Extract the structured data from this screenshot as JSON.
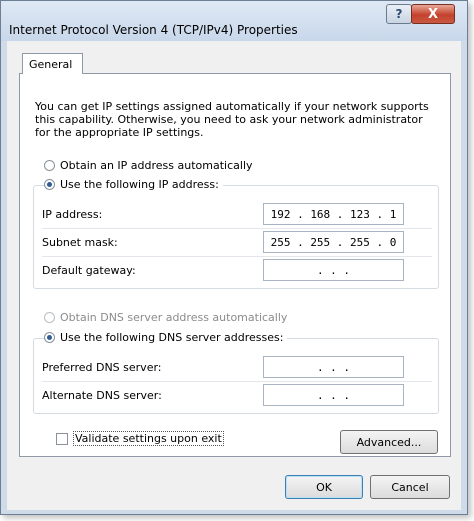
{
  "window": {
    "title": "Internet Protocol Version 4 (TCP/IPv4) Properties",
    "help_label": "?",
    "close_label": "X"
  },
  "tabs": [
    {
      "label": "General",
      "selected": true
    }
  ],
  "description": [
    "You can get IP settings assigned automatically if your network supports",
    "this capability. Otherwise, you need to ask your network administrator",
    "for the appropriate IP settings."
  ],
  "ip": {
    "auto_label": "Obtain an IP address automatically",
    "manual_label": "Use the following IP address:",
    "selected": "manual",
    "rows": [
      {
        "label": "IP address:",
        "value": "192 . 168 . 123 .  1"
      },
      {
        "label": "Subnet mask:",
        "value": "255 . 255 . 255 .  0"
      },
      {
        "label": "Default gateway:",
        "value": ".     .     ."
      }
    ]
  },
  "dns": {
    "auto_label": "Obtain DNS server address automatically",
    "manual_label": "Use the following DNS server addresses:",
    "selected": "manual",
    "rows": [
      {
        "label": "Preferred DNS server:",
        "value": ".     .     ."
      },
      {
        "label": "Alternate DNS server:",
        "value": ".     .     ."
      }
    ]
  },
  "validate": {
    "label": "Validate settings upon exit",
    "checked": false
  },
  "buttons": {
    "advanced": "Advanced...",
    "ok": "OK",
    "cancel": "Cancel"
  }
}
